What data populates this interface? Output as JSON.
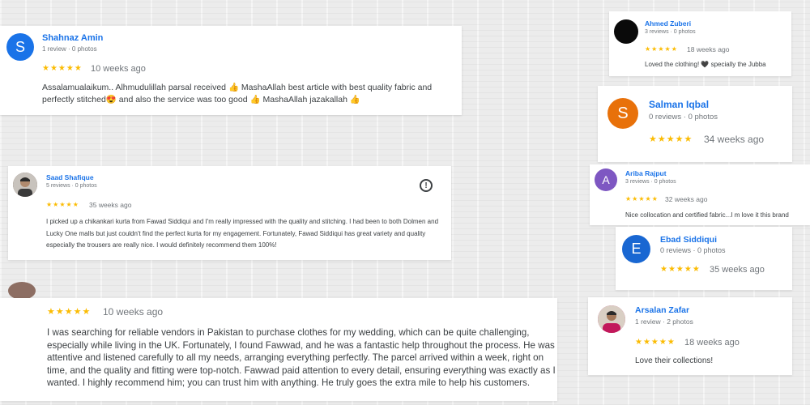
{
  "reviews": [
    {
      "name": "Shahnaz Amin",
      "meta": "1 review · 0 photos",
      "initial": "S",
      "avatar_color": "#1a73e8",
      "stars": "★★★★★",
      "ago": "10 weeks ago",
      "text": "Assalamualaikum.. Alhmudulillah parsal received 👍 MashaAllah best article with best quality fabric and perfectly stitched😍 and also the service was too good 👍 MashaAllah jazakallah 👍"
    },
    {
      "name": "Ahmed Zuberi",
      "meta": "3 reviews · 0 photos",
      "initial": "",
      "avatar_color": "#0a0a0a",
      "stars": "★★★★★",
      "ago": "18 weeks ago",
      "text": "Loved the clothing! 🖤 specially the Jubba"
    },
    {
      "name": "Salman Iqbal",
      "meta": "0 reviews · 0 photos",
      "initial": "S",
      "avatar_color": "#e8710a",
      "stars": "★★★★★",
      "ago": "34 weeks ago",
      "text": ""
    },
    {
      "name": "Saad Shafique",
      "meta": "5 reviews · 0 photos",
      "initial": "",
      "avatar_color": "#5d4037",
      "stars": "★★★★★",
      "ago": "35 weeks ago",
      "text": "I picked up a chikankari kurta from Fawad Siddiqui and I'm really impressed with the quality and stitching. I had been to both Dolmen and Lucky One malls but just couldn't find the perfect kurta for my engagement. Fortunately, Fawad Siddiqui has great variety and quality especially the trousers are really nice. I would definitely recommend them 100%!"
    },
    {
      "name": "Ariba Rajput",
      "meta": "3 reviews · 0 photos",
      "initial": "A",
      "avatar_color": "#7e57c2",
      "stars": "★★★★★",
      "ago": "32 weeks ago",
      "text": "Nice collocation and certified fabric...I m love it this brand"
    },
    {
      "name": "Ebad Siddiqui",
      "meta": "0 reviews · 0 photos",
      "initial": "E",
      "avatar_color": "#1967d2",
      "stars": "★★★★★",
      "ago": "35 weeks ago",
      "text": ""
    },
    {
      "name": "",
      "meta": "",
      "initial": "",
      "avatar_color": "#8d6e63",
      "stars": "★★★★★",
      "ago": "10 weeks ago",
      "text": "I was searching for reliable vendors in Pakistan to purchase clothes for my wedding, which can be quite challenging, especially while living in the UK. Fortunately, I found Fawwad, and he was a fantastic help throughout the process. He was attentive and listened carefully to all my needs, arranging everything perfectly. The parcel arrived within a week, right on time, and the quality and fitting were top-notch. Fawwad paid attention to every detail, ensuring everything was exactly as I wanted. I highly recommend him; you can trust him with anything. He truly goes the extra mile to help his customers."
    },
    {
      "name": "Arsalan Zafar",
      "meta": "1 review · 2 photos",
      "initial": "",
      "avatar_color": "#c2185b",
      "stars": "★★★★★",
      "ago": "18 weeks ago",
      "text": "Love their collections!"
    }
  ],
  "icons": {
    "flag": "flag-report-icon",
    "flag_glyph": "!"
  }
}
